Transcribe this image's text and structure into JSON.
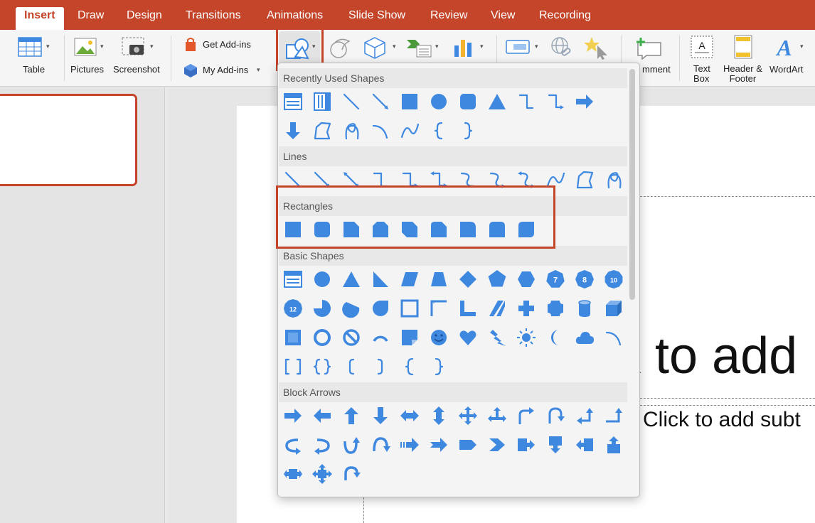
{
  "colors": {
    "accent": "#c4452a",
    "shape_blue": "#3f88e0",
    "highlight_box": "#c4452a"
  },
  "tabs": {
    "insert": "Insert",
    "draw": "Draw",
    "design": "Design",
    "transitions": "Transitions",
    "animations": "Animations",
    "slide_show": "Slide Show",
    "review": "Review",
    "view": "View",
    "recording": "Recording"
  },
  "ribbon": {
    "table": "Table",
    "pictures": "Pictures",
    "screenshot": "Screenshot",
    "get_addins": "Get Add-ins",
    "my_addins": "My Add-ins",
    "comment_partial": "mment",
    "text_box_line1": "Text",
    "text_box_line2": "Box",
    "header_footer_line1": "Header &",
    "header_footer_line2": "Footer",
    "wordart": "WordArt",
    "icons": [
      "table-icon",
      "pictures-icon",
      "screenshot-icon",
      "get-addins-icon",
      "my-addins-icon",
      "shapes-icon",
      "icons-icon",
      "3d-models-icon",
      "smartart-icon",
      "chart-icon",
      "action-icon",
      "link-icon",
      "star-cursor-icon",
      "comment-icon",
      "text-box-icon",
      "header-footer-icon",
      "wordart-icon"
    ]
  },
  "shapes_menu": {
    "sections": [
      {
        "title": "Recently Used Shapes",
        "shapes": [
          "text-box",
          "vertical-text-box",
          "line",
          "arrow-line",
          "rectangle",
          "oval",
          "rounded-rectangle",
          "triangle",
          "elbow-connector",
          "elbow-arrow-connector",
          "right-arrow",
          "down-arrow",
          "freeform",
          "scribble",
          "arc",
          "curve",
          "left-brace",
          "right-brace"
        ]
      },
      {
        "title": "Lines",
        "shapes": [
          "line",
          "line-arrow",
          "double-arrow",
          "elbow-connector",
          "elbow-arrow",
          "elbow-double-arrow",
          "curved-connector",
          "curved-arrow",
          "curved-double-arrow",
          "curve",
          "freeform",
          "scribble"
        ]
      },
      {
        "title": "Rectangles",
        "shapes": [
          "rectangle",
          "rounded-rectangle",
          "snip-single-corner",
          "snip-same-side",
          "snip-diagonal",
          "snip-round-single",
          "round-single-corner",
          "round-same-side",
          "round-diagonal"
        ]
      },
      {
        "title": "Basic Shapes",
        "shapes": [
          "text-box",
          "oval",
          "triangle",
          "right-triangle",
          "parallelogram",
          "trapezoid",
          "diamond",
          "pentagon",
          "hexagon",
          "heptagon",
          "octagon",
          "decagon",
          "dodecagon",
          "pie",
          "chord",
          "teardrop",
          "frame",
          "half-frame",
          "l-shape",
          "diagonal-stripe",
          "cross",
          "plaque",
          "can",
          "cube",
          "bevel",
          "donut",
          "no-symbol",
          "block-arc",
          "folded-corner",
          "smiley",
          "heart",
          "lightning",
          "sun",
          "moon",
          "cloud",
          "arc",
          "double-bracket",
          "double-brace",
          "left-bracket",
          "right-bracket",
          "left-brace",
          "right-brace"
        ]
      },
      {
        "title": "Block Arrows",
        "shapes": [
          "right-arrow",
          "left-arrow",
          "up-arrow",
          "down-arrow",
          "left-right-arrow",
          "up-down-arrow",
          "quad-arrow",
          "left-right-up-arrow",
          "bent-arrow",
          "u-turn-arrow",
          "left-up-arrow",
          "bent-up-arrow",
          "curved-right-arrow",
          "curved-left-arrow",
          "curved-up-arrow",
          "curved-down-arrow",
          "striped-right-arrow",
          "notched-right-arrow",
          "pentagon-arrow",
          "chevron",
          "right-arrow-callout",
          "down-arrow-callout",
          "left-arrow-callout",
          "up-arrow-callout",
          "left-right-arrow-callout",
          "quad-arrow-callout",
          "circular-arrow"
        ]
      }
    ],
    "basic_number_labels": {
      "heptagon": "7",
      "octagon": "8",
      "decagon": "10",
      "dodecagon": "12"
    }
  },
  "slide": {
    "title_placeholder_partial": "k to add",
    "subtitle_placeholder_partial": "Click to add subt"
  }
}
